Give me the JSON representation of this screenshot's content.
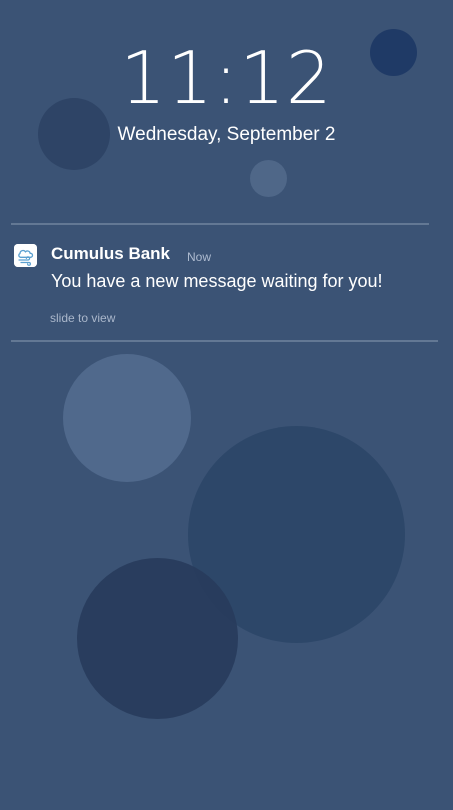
{
  "lock_screen": {
    "time": "11:12",
    "date": "Wednesday, September 2"
  },
  "notification": {
    "app_icon": "cloud-wind-icon",
    "app_name": "Cumulus Bank",
    "time_ago": "Now",
    "message": "You have a new message waiting for you!",
    "action_hint": "slide to view"
  },
  "colors": {
    "background": "#3b5375",
    "divider": "#637894",
    "secondary_text": "#aebbd0",
    "icon_accent": "#5ba0d0"
  }
}
